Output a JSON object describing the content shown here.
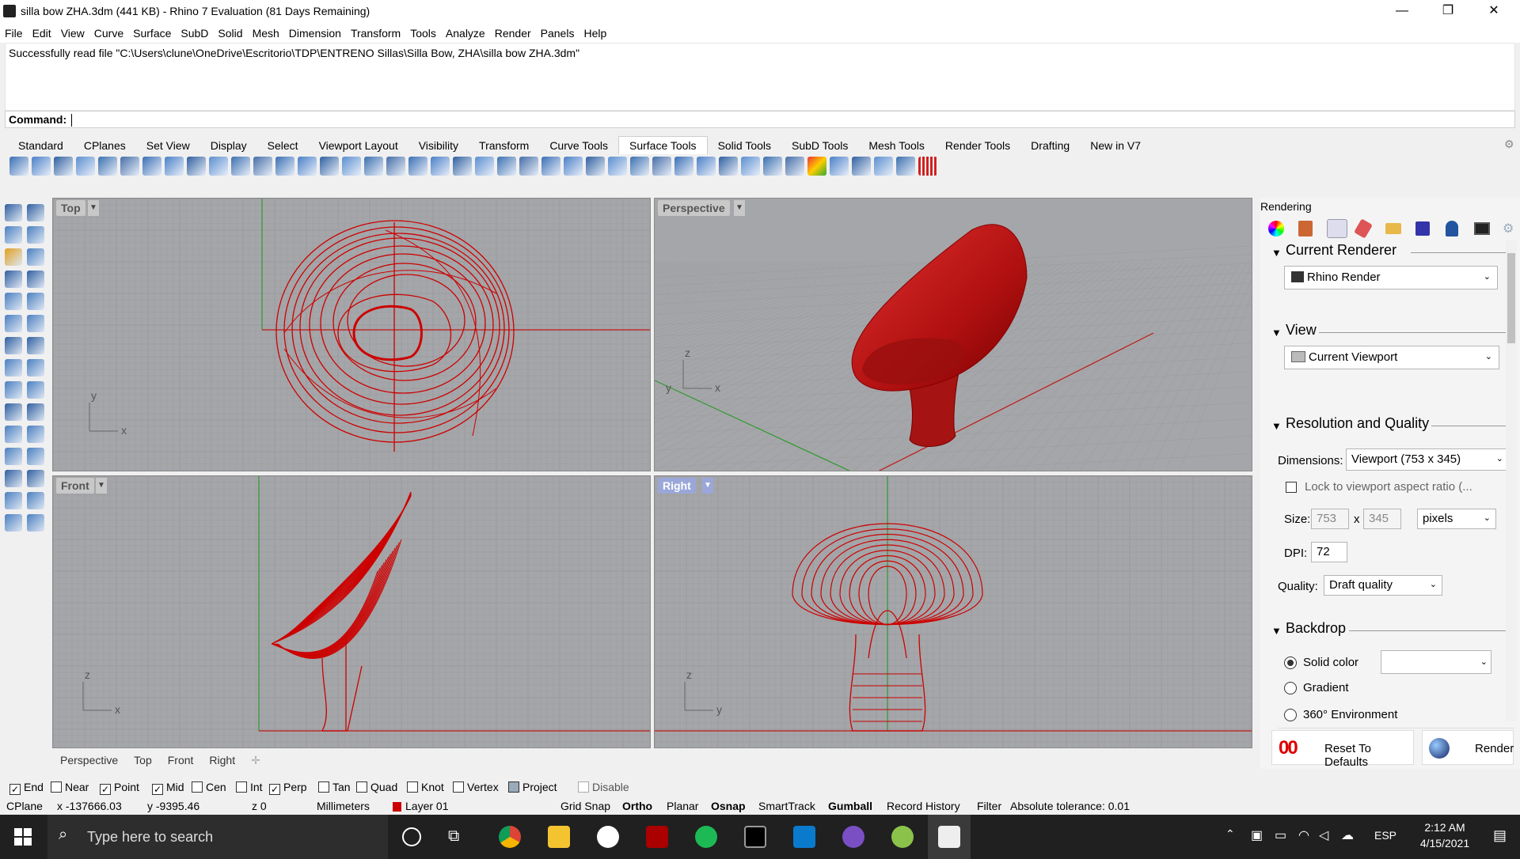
{
  "window": {
    "title": "silla bow ZHA.3dm (441 KB) - Rhino 7 Evaluation (81 Days Remaining)",
    "controls": [
      "—",
      "❐",
      "✕"
    ]
  },
  "menu": [
    "File",
    "Edit",
    "View",
    "Curve",
    "Surface",
    "SubD",
    "Solid",
    "Mesh",
    "Dimension",
    "Transform",
    "Tools",
    "Analyze",
    "Render",
    "Panels",
    "Help"
  ],
  "command": {
    "history": "Successfully read file \"C:\\Users\\clune\\OneDrive\\Escritorio\\TDP\\ENTRENO Sillas\\Silla Bow, ZHA\\silla bow ZHA.3dm\"",
    "label": "Command:"
  },
  "toolbar_tabs": [
    "Standard",
    "CPlanes",
    "Set View",
    "Display",
    "Select",
    "Viewport Layout",
    "Visibility",
    "Transform",
    "Curve Tools",
    "Surface Tools",
    "Solid Tools",
    "SubD Tools",
    "Mesh Tools",
    "Render Tools",
    "Drafting",
    "New in V7"
  ],
  "active_toolbar_tab": "Surface Tools",
  "viewports": {
    "top": "Top",
    "perspective": "Perspective",
    "front": "Front",
    "right": "Right",
    "active": "Right",
    "tabs": [
      "Perspective",
      "Top",
      "Front",
      "Right"
    ],
    "axis_x": "x",
    "axis_y": "y",
    "axis_z": "z"
  },
  "rendering_panel": {
    "title": "Rendering",
    "current_renderer_heading": "Current Renderer",
    "renderer": "Rhino Render",
    "view_heading": "View",
    "view": "Current Viewport",
    "res_heading": "Resolution and Quality",
    "dimensions_label": "Dimensions:",
    "dimensions_value": "Viewport (753 x 345)",
    "lock_label": "Lock to viewport aspect ratio (...",
    "size_label": "Size:",
    "size_w": "753",
    "size_x": "x",
    "size_h": "345",
    "size_unit": "pixels",
    "dpi_label": "DPI:",
    "dpi_value": "72",
    "quality_label": "Quality:",
    "quality_value": "Draft quality",
    "backdrop_heading": "Backdrop",
    "solid_color": "Solid color",
    "gradient": "Gradient",
    "env": "360° Environment",
    "reset_label": "Reset To Defaults",
    "render_label": "Render"
  },
  "osnaps": [
    {
      "label": "End",
      "checked": true
    },
    {
      "label": "Near",
      "checked": false
    },
    {
      "label": "Point",
      "checked": true
    },
    {
      "label": "Mid",
      "checked": true
    },
    {
      "label": "Cen",
      "checked": false
    },
    {
      "label": "Int",
      "checked": false
    },
    {
      "label": "Perp",
      "checked": true
    },
    {
      "label": "Tan",
      "checked": false
    },
    {
      "label": "Quad",
      "checked": false
    },
    {
      "label": "Knot",
      "checked": false
    },
    {
      "label": "Vertex",
      "checked": false
    },
    {
      "label": "Project",
      "checked": false
    },
    {
      "label": "Disable",
      "checked": false
    }
  ],
  "status": {
    "cplane": "CPlane",
    "x": "x -137666.03",
    "y": "y -9395.46",
    "z": "z 0",
    "units": "Millimeters",
    "layer": "Layer 01",
    "grid_snap": "Grid Snap",
    "ortho": "Ortho",
    "planar": "Planar",
    "osnap": "Osnap",
    "smarttrack": "SmartTrack",
    "gumball": "Gumball",
    "record_history": "Record History",
    "filter": "Filter",
    "tolerance": "Absolute tolerance: 0.01"
  },
  "taskbar": {
    "search_placeholder": "Type here to search",
    "lang": "ESP",
    "time": "2:12 AM",
    "date": "4/15/2021"
  },
  "colors": {
    "curve_red": "#cc0000",
    "viewport_bg": "#a5a6a9",
    "grid_line": "#9a9b9e",
    "axis_green": "#2e9a2e",
    "axis_red": "#c01818",
    "active_label": "#9aa7d8"
  }
}
